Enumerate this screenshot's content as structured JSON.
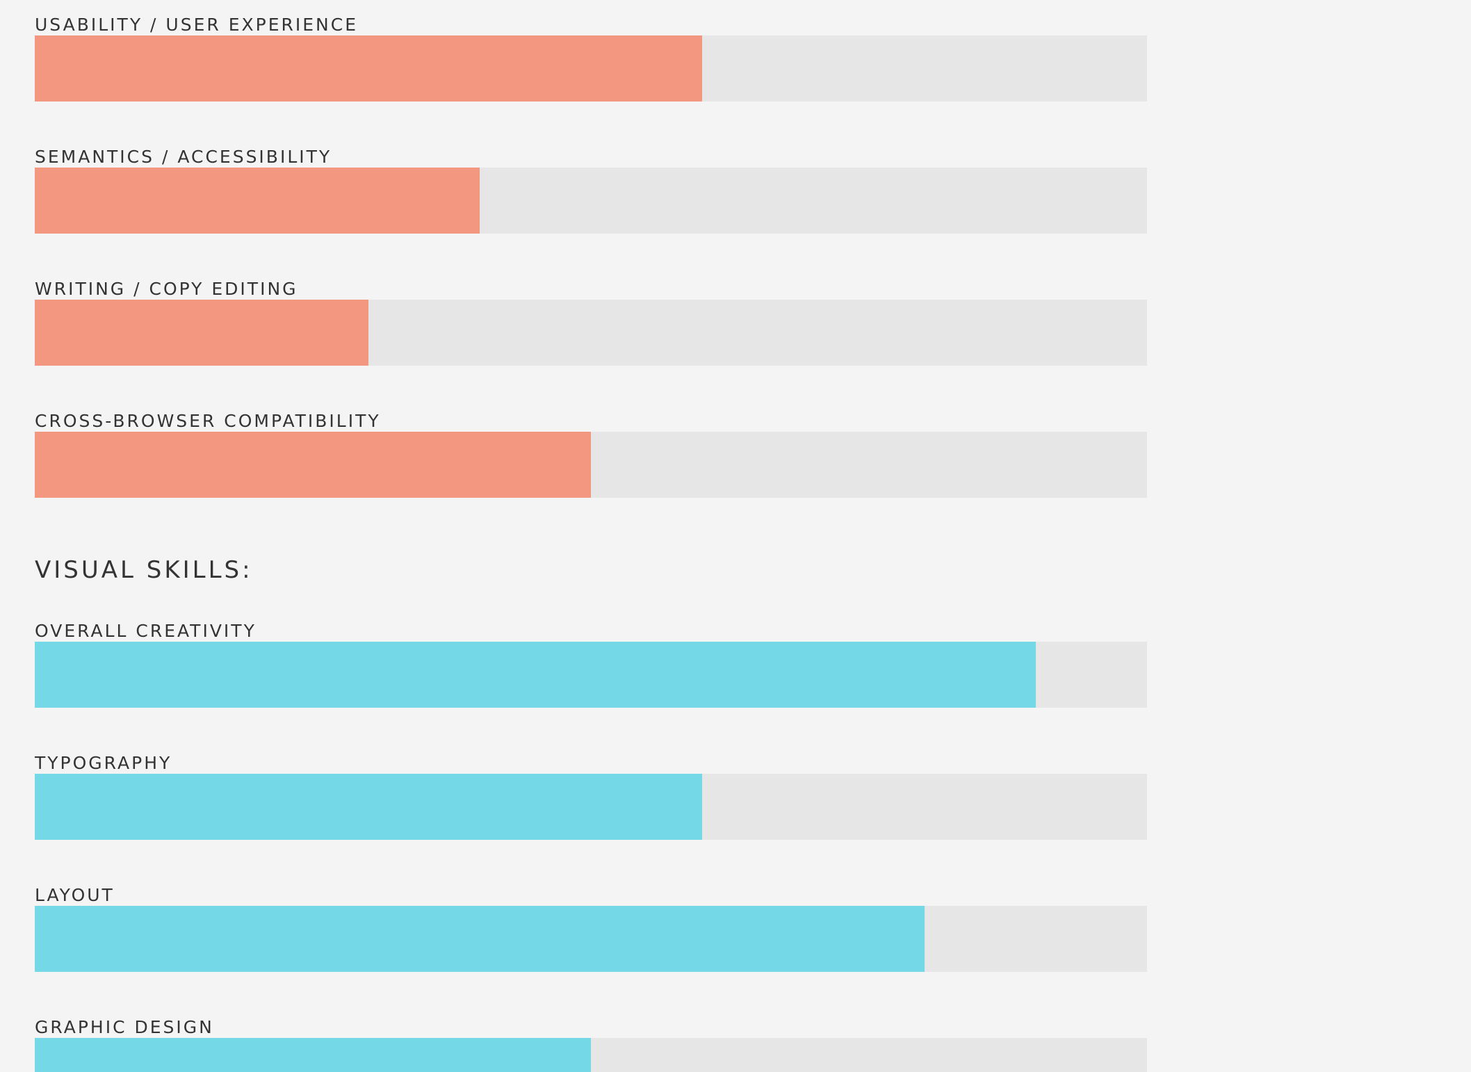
{
  "technical_skills": [
    {
      "label": "USABILITY / USER EXPERIENCE",
      "level": 0.6
    },
    {
      "label": "SEMANTICS / ACCESSIBILITY",
      "level": 0.4
    },
    {
      "label": "WRITING / COPY EDITING",
      "level": 0.3
    },
    {
      "label": "CROSS-BROWSER COMPATIBILITY",
      "level": 0.5
    }
  ],
  "visual_section": {
    "heading": "VISUAL SKILLS:"
  },
  "visual_skills": [
    {
      "label": "OVERALL CREATIVITY",
      "level": 0.9
    },
    {
      "label": "TYPOGRAPHY",
      "level": 0.6
    },
    {
      "label": "LAYOUT",
      "level": 0.8
    },
    {
      "label": "GRAPHIC DESIGN",
      "level": 0.5
    }
  ],
  "colors": {
    "background": "#f4f4f4",
    "track": "#e6e6e6",
    "technical_fill": "#f39781",
    "visual_fill": "#75d8e6",
    "text": "#333333"
  }
}
